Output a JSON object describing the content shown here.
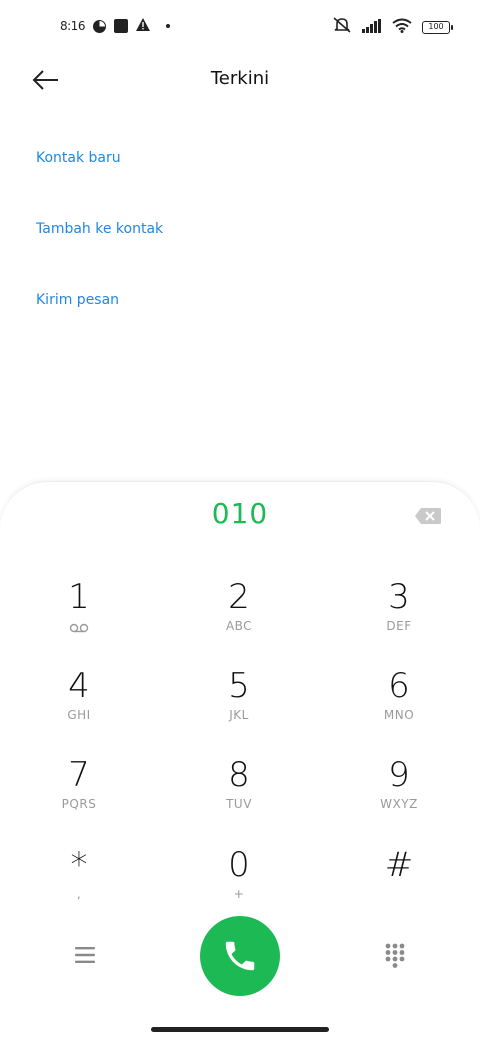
{
  "status_bar": {
    "time": "8:16",
    "battery": "100",
    "icons": [
      "data-saver-icon",
      "square-notification-icon",
      "warning-icon",
      "dot-icon",
      "muted-icon",
      "signal-icon",
      "wifi-icon",
      "battery-icon"
    ]
  },
  "header": {
    "title": "Terkini"
  },
  "options": {
    "new_contact": "Kontak baru",
    "add_to_contact": "Tambah ke kontak",
    "send_message": "Kirim pesan"
  },
  "dialer": {
    "number": "010",
    "keys": [
      {
        "digit": "1",
        "letters": ""
      },
      {
        "digit": "2",
        "letters": "ABC"
      },
      {
        "digit": "3",
        "letters": "DEF"
      },
      {
        "digit": "4",
        "letters": "GHI"
      },
      {
        "digit": "5",
        "letters": "JKL"
      },
      {
        "digit": "6",
        "letters": "MNO"
      },
      {
        "digit": "7",
        "letters": "PQRS"
      },
      {
        "digit": "8",
        "letters": "TUV"
      },
      {
        "digit": "9",
        "letters": "WXYZ"
      },
      {
        "digit": "*",
        "letters": ","
      },
      {
        "digit": "0",
        "letters": "+"
      },
      {
        "digit": "#",
        "letters": ""
      }
    ]
  },
  "colors": {
    "accent_green": "#1DB954",
    "link_blue": "#1E88E5"
  }
}
